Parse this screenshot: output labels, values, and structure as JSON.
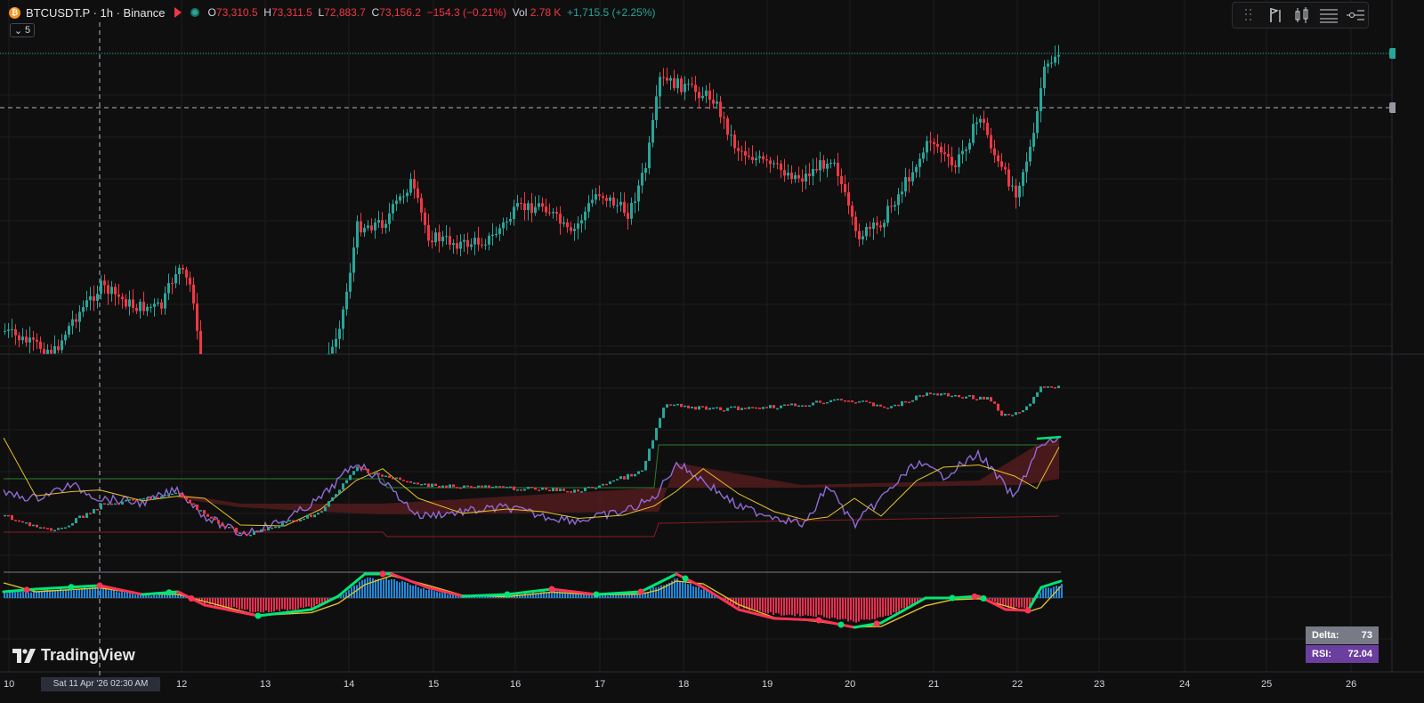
{
  "header": {
    "coin_glyph": "₿",
    "symbol_interval_exchange": "BTCUSDT.P · 1h · Binance",
    "open_label": "O",
    "open_value": "73,310.5",
    "high_label": "H",
    "high_value": "73,311.5",
    "low_label": "L",
    "low_value": "72,883.7",
    "close_label": "C",
    "close_value": "73,156.2",
    "change": "−154.3 (−0.21%)",
    "vol_label": "Vol",
    "vol_value": "2.78 K",
    "vol_change": "+1,715.5 (+2.25%)",
    "collapse_count": "5"
  },
  "colors": {
    "background": "#0f0f0f",
    "up": "#26a69a",
    "down": "#f23645",
    "rsi_line": "#8f6bd6",
    "signal": "#e6c229",
    "fill": "#5c1d1f",
    "macd_up": "#00e676",
    "macd_down": "#ff3355",
    "hist_up": "#2196f3",
    "delta_badge": "#787b86",
    "rsi_badge": "#6a3fa0"
  },
  "toolbar": {
    "icons": [
      "drag-handle-icon",
      "flag-indicator-icon",
      "candles-icon",
      "lines-icon",
      "settings-line-icon"
    ]
  },
  "watermark": {
    "text": "TradingView"
  },
  "x_axis": {
    "crosshair_date": "Sat 11 Apr '26   02:30 AM",
    "labels": [
      "10",
      "12",
      "13",
      "14",
      "15",
      "16",
      "17",
      "18",
      "19",
      "20",
      "21",
      "22",
      "23",
      "24",
      "25",
      "26"
    ]
  },
  "badges": {
    "delta_label": "Delta:",
    "delta_value": "73",
    "rsi_label": "RSI:",
    "rsi_value": "72.04"
  }
}
